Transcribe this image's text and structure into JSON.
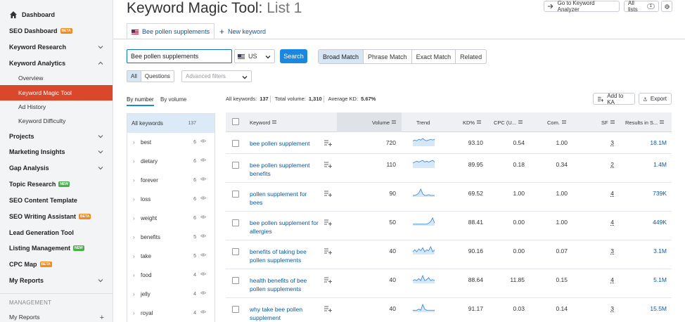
{
  "sidebar": {
    "items": [
      {
        "label": "Dashboard",
        "type": "home"
      },
      {
        "label": "SEO Dashboard",
        "badge": "BETA"
      },
      {
        "label": "Keyword Research",
        "chevron": "down"
      },
      {
        "label": "Keyword Analytics",
        "chevron": "up"
      },
      {
        "label": "Overview",
        "sub": true
      },
      {
        "label": "Keyword Magic Tool",
        "sub": true,
        "active": true
      },
      {
        "label": "Ad History",
        "sub": true
      },
      {
        "label": "Keyword Difficulty",
        "sub": true
      },
      {
        "label": "Projects",
        "chevron": "down"
      },
      {
        "label": "Marketing Insights",
        "chevron": "down"
      },
      {
        "label": "Gap Analysis",
        "chevron": "down"
      },
      {
        "label": "Topic Research",
        "badge": "NEW"
      },
      {
        "label": "SEO Content Template"
      },
      {
        "label": "SEO Writing Assistant",
        "badge": "BETA"
      },
      {
        "label": "Lead Generation Tool"
      },
      {
        "label": "Listing Management",
        "badge": "NEW"
      },
      {
        "label": "CPC Map",
        "badge": "BETA"
      },
      {
        "label": "My Reports",
        "chevron": "down"
      }
    ],
    "management_label": "MANAGEMENT",
    "my_reports_label": "My Reports",
    "plus": "+"
  },
  "header": {
    "title_main": "Keyword Magic Tool:",
    "title_list": "List 1",
    "goto_button": "Go to Keyword Analyzer",
    "all_lists_button": "All lists",
    "all_lists_count": "1"
  },
  "tabs": {
    "active_tab": "Bee pollen supplements",
    "new_keyword": "New keyword"
  },
  "search": {
    "value": "Bee pollen supplements",
    "database": "US",
    "search_button": "Search",
    "match_options": [
      "Broad Match",
      "Phrase Match",
      "Exact Match",
      "Related"
    ],
    "active_match": "Broad Match"
  },
  "filters": {
    "all": "All",
    "questions": "Questions",
    "advanced_placeholder": "Advanced filters"
  },
  "group_tabs": {
    "by_number": "By number",
    "by_volume": "By volume"
  },
  "groups": [
    {
      "label": "All keywords",
      "count": "137"
    },
    {
      "label": "best",
      "count": "6"
    },
    {
      "label": "dietary",
      "count": "6"
    },
    {
      "label": "forever",
      "count": "6"
    },
    {
      "label": "loss",
      "count": "6"
    },
    {
      "label": "weight",
      "count": "6"
    },
    {
      "label": "benefits",
      "count": "5"
    },
    {
      "label": "take",
      "count": "5"
    },
    {
      "label": "food",
      "count": "4"
    },
    {
      "label": "jelly",
      "count": "4"
    },
    {
      "label": "royal",
      "count": "4"
    }
  ],
  "stats": {
    "all_keywords_label": "All keywords:",
    "all_keywords_value": "137",
    "total_volume_label": "Total volume:",
    "total_volume_value": "1,310",
    "avg_kd_label": "Average KD:",
    "avg_kd_value": "5.67%"
  },
  "actions": {
    "add_to_ka": "Add to KA",
    "export": "Export"
  },
  "table": {
    "headers": {
      "keyword": "Keyword",
      "volume": "Volume",
      "trend": "Trend",
      "kd": "KD%",
      "cpc": "CPC (U...",
      "com": "Com.",
      "sf": "SF",
      "results": "Results in S..."
    },
    "rows": [
      {
        "keyword": "bee pollen supplement",
        "volume": "720",
        "kd": "93.10",
        "cpc": "0.54",
        "com": "1.00",
        "sf": "3",
        "results": "18.1M",
        "trend": [
          6,
          7,
          6,
          8,
          7,
          9,
          7,
          6,
          7,
          8,
          7,
          8
        ]
      },
      {
        "keyword": "bee pollen supplement benefits",
        "volume": "110",
        "kd": "89.95",
        "cpc": "0.18",
        "com": "0.34",
        "sf": "2",
        "results": "1.4M",
        "trend": [
          5,
          6,
          7,
          6,
          7,
          8,
          6,
          7,
          6,
          7,
          8,
          6
        ]
      },
      {
        "keyword": "pollen supplement for bees",
        "volume": "90",
        "kd": "69.52",
        "cpc": "1.00",
        "com": "1.00",
        "sf": "4",
        "results": "739K",
        "trend": [
          1,
          1,
          2,
          4,
          9,
          3,
          1,
          1,
          2,
          1,
          1,
          1
        ]
      },
      {
        "keyword": "bee pollen supplement for allergies",
        "volume": "50",
        "kd": "88.41",
        "cpc": "0.00",
        "com": "1.00",
        "sf": "4",
        "results": "449K",
        "trend": [
          1,
          1,
          1,
          1,
          1,
          1,
          1,
          1,
          2,
          4,
          8,
          2
        ]
      },
      {
        "keyword": "benefits of taking bee pollen supplements",
        "volume": "40",
        "kd": "90.16",
        "cpc": "0.00",
        "com": "0.07",
        "sf": "3",
        "results": "3.1M",
        "trend": [
          2,
          4,
          2,
          5,
          3,
          6,
          2,
          4,
          3,
          7,
          2,
          4
        ]
      },
      {
        "keyword": "health benefits of bee pollen supplements",
        "volume": "40",
        "kd": "88.64",
        "cpc": "11.85",
        "com": "0.15",
        "sf": "4",
        "results": "5.1M",
        "trend": [
          2,
          3,
          2,
          4,
          2,
          7,
          2,
          3,
          5,
          2,
          3,
          2
        ]
      },
      {
        "keyword": "why take bee pollen supplement",
        "volume": "40",
        "kd": "91.17",
        "cpc": "0.03",
        "com": "0.14",
        "sf": "3",
        "results": "15.5M",
        "trend": [
          1,
          1,
          1,
          2,
          1,
          6,
          2,
          1,
          1,
          1,
          1,
          1
        ]
      }
    ]
  },
  "colors": {
    "accent": "#1a87e0",
    "active_sidebar": "#d9482b",
    "link": "#0b5aa0"
  }
}
